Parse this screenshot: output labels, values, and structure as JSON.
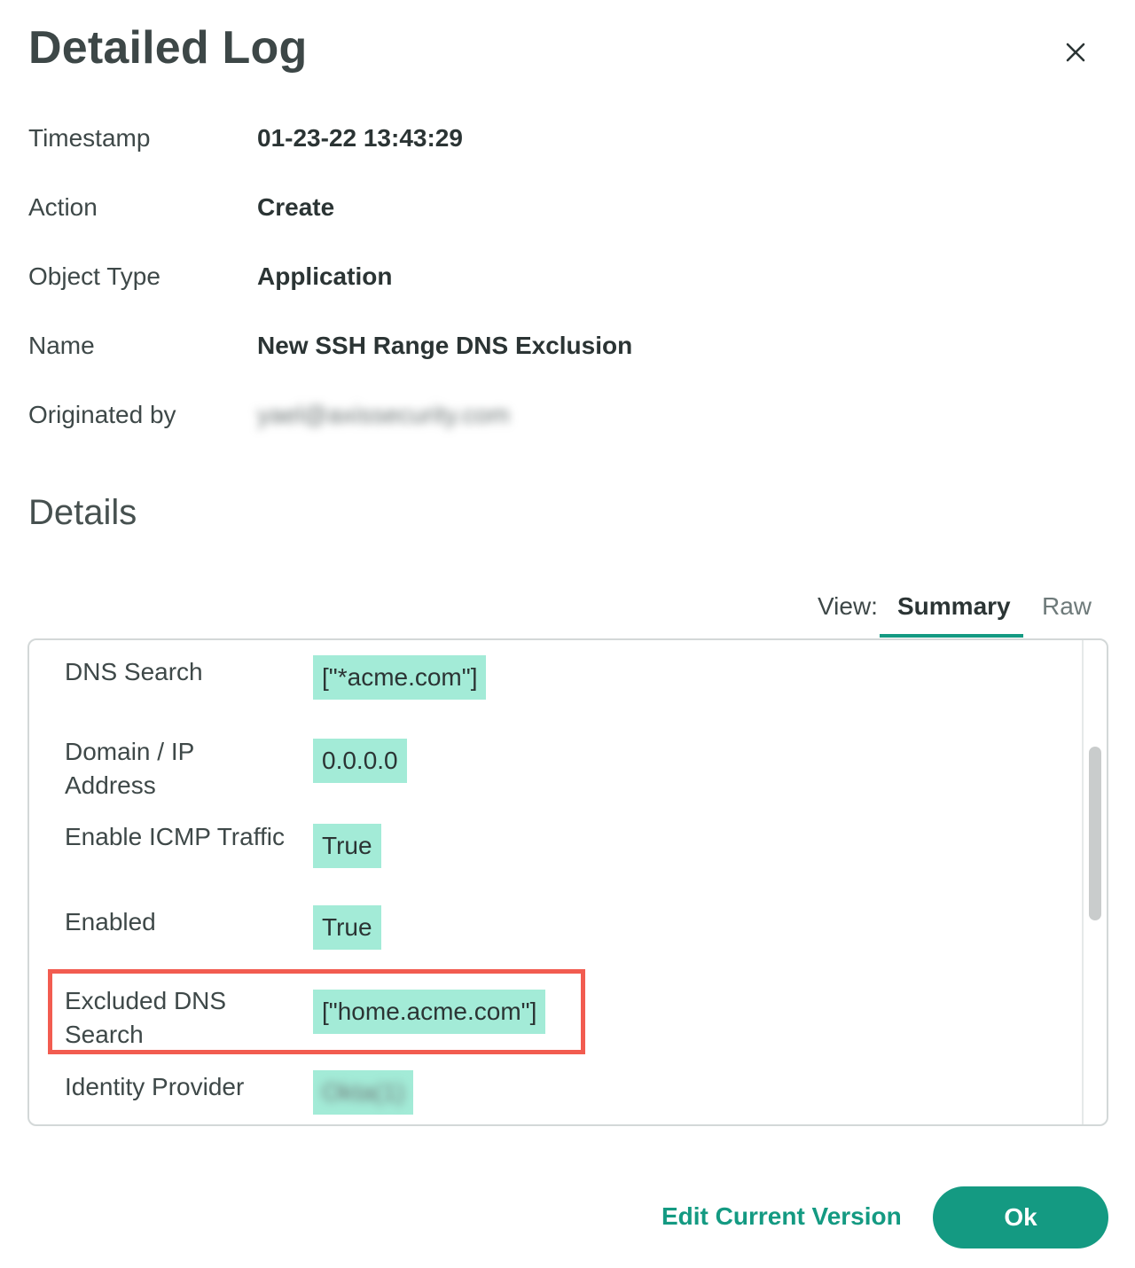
{
  "dialog": {
    "title": "Detailed Log",
    "close_icon": "close-icon"
  },
  "meta": [
    {
      "label": "Timestamp",
      "value": "01-23-22 13:43:29"
    },
    {
      "label": "Action",
      "value": "Create"
    },
    {
      "label": "Object Type",
      "value": "Application"
    },
    {
      "label": "Name",
      "value": "New SSH Range DNS Exclusion"
    },
    {
      "label": "Originated by",
      "value": "yael@axissecurity.com"
    }
  ],
  "details": {
    "title": "Details",
    "view_label": "View:",
    "tabs": [
      {
        "label": "Summary",
        "active": true
      },
      {
        "label": "Raw",
        "active": false
      }
    ],
    "rows": [
      {
        "label": "DNS Search",
        "value": "[\"*acme.com\"]"
      },
      {
        "label": "Domain / IP Address",
        "value": "0.0.0.0"
      },
      {
        "label": "Enable ICMP Traffic",
        "value": "True"
      },
      {
        "label": "Enabled",
        "value": "True"
      },
      {
        "label": "Excluded DNS Search",
        "value": "[\"home.acme.com\"]",
        "highlighted": true
      },
      {
        "label": "Identity Provider",
        "value": "Okta(1)"
      }
    ]
  },
  "footer": {
    "edit_label": "Edit Current Version",
    "ok_label": "Ok"
  },
  "colors": {
    "accent": "#149a82",
    "value_highlight": "#a3ebd7",
    "callout_border": "#f25c50"
  }
}
